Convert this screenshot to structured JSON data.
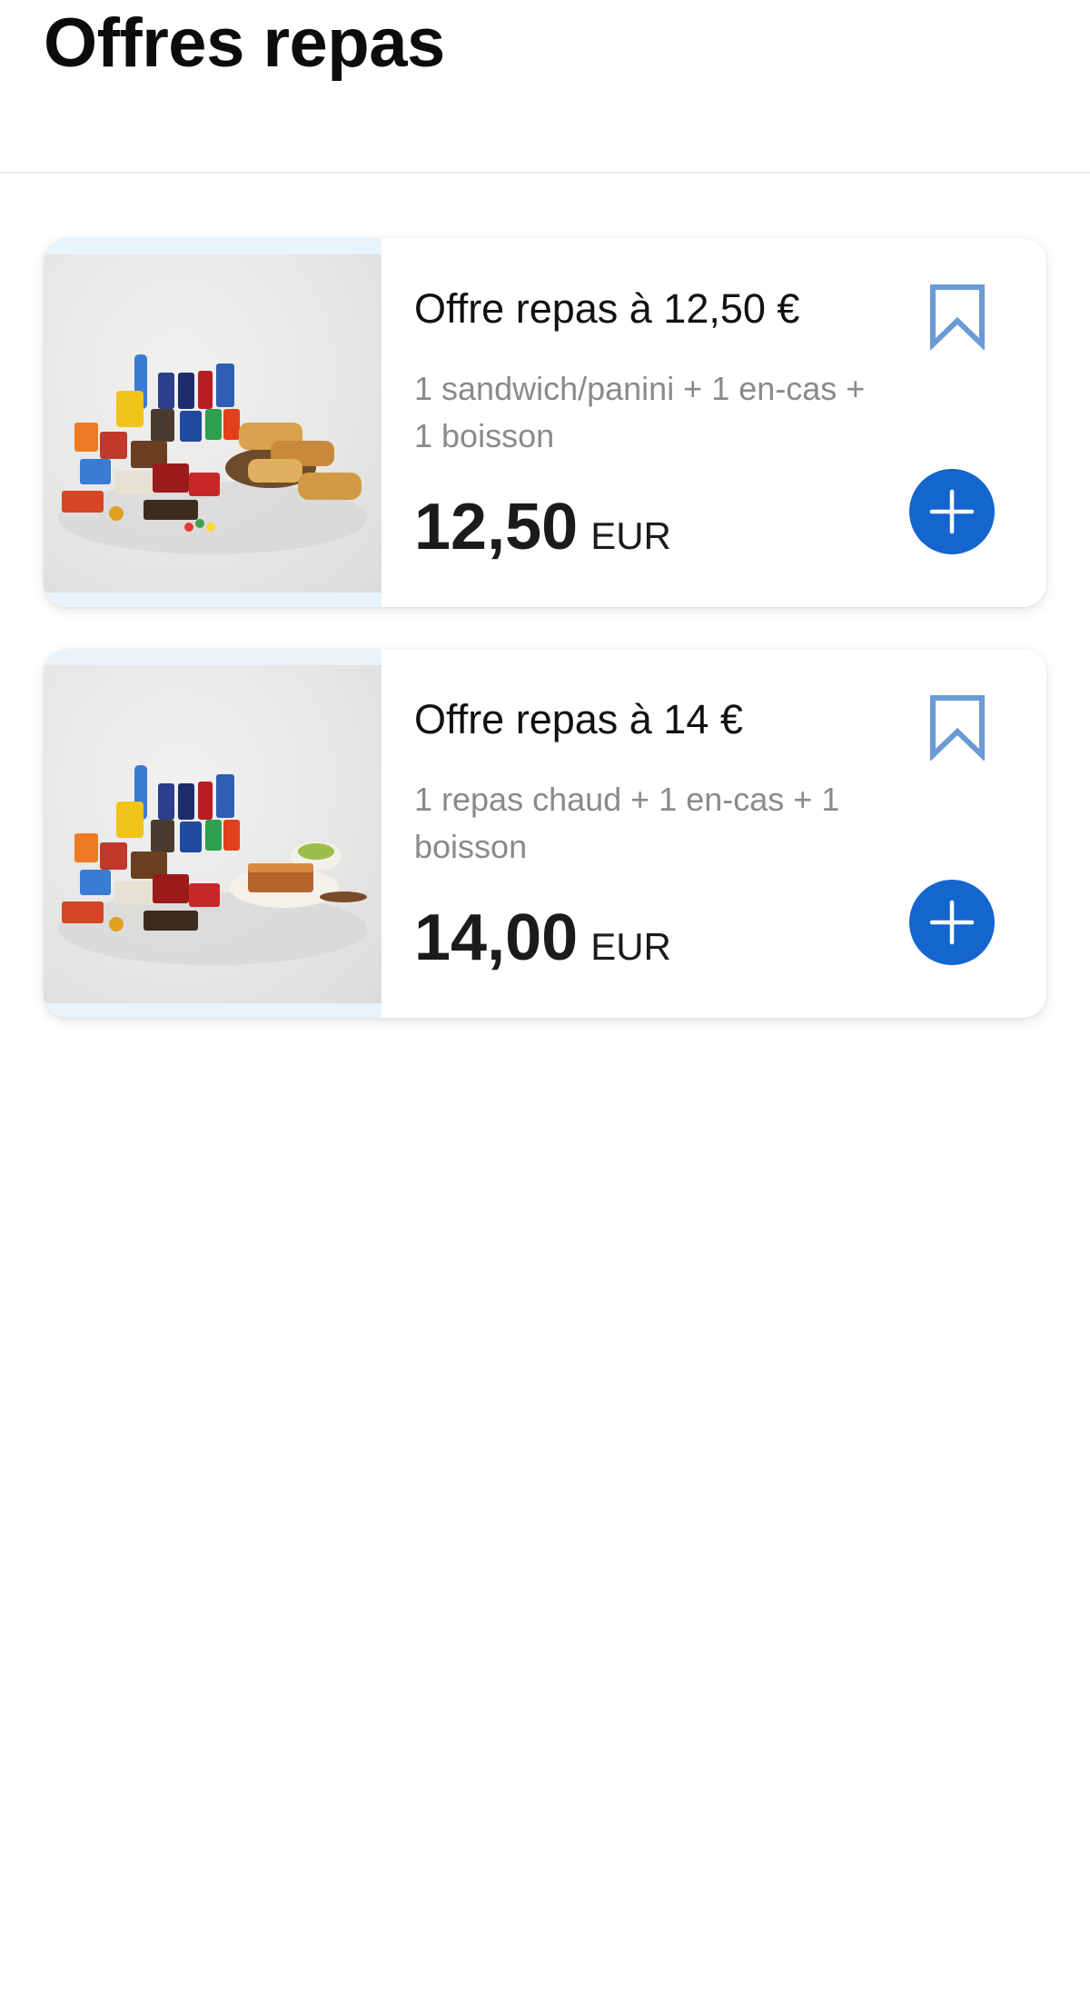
{
  "header": {
    "title": "Offres repas"
  },
  "theme": {
    "accent": "#1565cf",
    "bookmark": "#6a9bd6",
    "muted_text": "#8a8a8a",
    "image_backdrop": "#e9f3fc"
  },
  "offers": [
    {
      "title": "Offre repas à 12,50 €",
      "description": "1 sandwich/panini + 1 en-cas + 1 boisson",
      "price": "12,50",
      "currency": "EUR",
      "image_icon": "meal-deal-sandwich-photo",
      "bookmark_icon": "bookmark-outline-icon",
      "add_icon": "plus-icon"
    },
    {
      "title": "Offre repas à 14 €",
      "description": "1 repas chaud + 1 en-cas + 1 boisson",
      "price": "14,00",
      "currency": "EUR",
      "image_icon": "meal-deal-hot-meal-photo",
      "bookmark_icon": "bookmark-outline-icon",
      "add_icon": "plus-icon"
    }
  ]
}
